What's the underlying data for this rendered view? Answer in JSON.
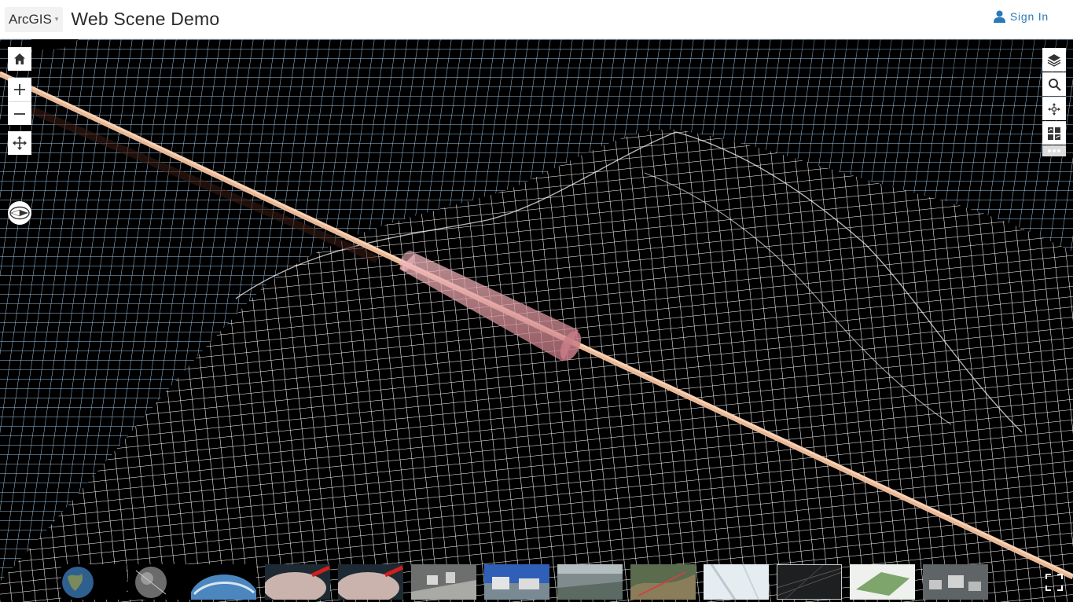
{
  "header": {
    "brand": "ArcGIS",
    "brand_caret": "▾",
    "title": "Web Scene Demo",
    "signin_label": "Sign In"
  },
  "colors": {
    "accent": "#2a7ab8",
    "pipe": "#f2c7a5",
    "tunnel": "#e8a0a8",
    "grid_flat": "#9fc8e8",
    "grid_terrain": "#ffffff"
  },
  "left_tools": [
    {
      "name": "home-button",
      "icon": "home-icon"
    },
    {
      "name": "zoom-in-button",
      "icon": "plus-icon"
    },
    {
      "name": "zoom-out-button",
      "icon": "minus-icon"
    },
    {
      "name": "navigation-toggle-button",
      "icon": "pan-icon"
    },
    {
      "name": "compass-button",
      "icon": "compass-icon"
    }
  ],
  "right_tools": [
    {
      "name": "layer-list-button",
      "icon": "layers-icon"
    },
    {
      "name": "search-button",
      "icon": "search-icon"
    },
    {
      "name": "locate-button",
      "icon": "move-icon"
    },
    {
      "name": "basemap-gallery-button",
      "icon": "basemap-icon"
    },
    {
      "name": "more-tools-button",
      "icon": "more-icon"
    }
  ],
  "slides": [
    {
      "name": "slide-1",
      "theme": "globe"
    },
    {
      "name": "slide-2",
      "theme": "globe-dark"
    },
    {
      "name": "slide-3",
      "theme": "earth-horizon"
    },
    {
      "name": "slide-4",
      "theme": "terrain-red"
    },
    {
      "name": "slide-5",
      "theme": "terrain-red"
    },
    {
      "name": "slide-6",
      "theme": "city-grey"
    },
    {
      "name": "slide-7",
      "theme": "city-blue"
    },
    {
      "name": "slide-8",
      "theme": "aerial"
    },
    {
      "name": "slide-9",
      "theme": "valley"
    },
    {
      "name": "slide-10",
      "theme": "light-map"
    },
    {
      "name": "slide-11",
      "theme": "wireframe"
    },
    {
      "name": "slide-12",
      "theme": "green-map"
    },
    {
      "name": "slide-13",
      "theme": "urban"
    }
  ]
}
